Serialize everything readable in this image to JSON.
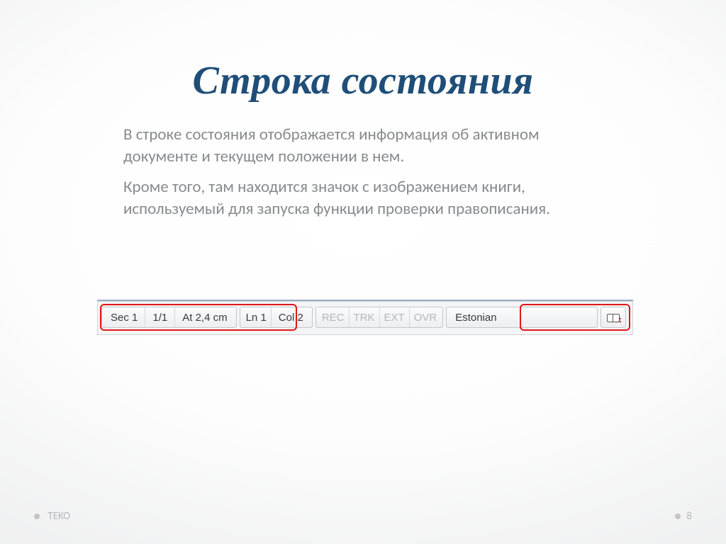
{
  "title": "Строка состояния",
  "body": {
    "p1": "В строке состояния отображается информация об активном документе и текущем положении в нем.",
    "p2": "Кроме того, там находится значок с изображением книги, используемый для запуска функции проверки правописания."
  },
  "statusbar": {
    "section": "Sec 1",
    "page": "1/1",
    "at_label": "At",
    "at_value": "2,4 cm",
    "ln_label": "Ln",
    "ln_value": "1",
    "col_label": "Col",
    "col_value": "2",
    "modes": {
      "rec": "REC",
      "trk": "TRK",
      "ext": "EXT",
      "ovr": "OVR"
    },
    "language": "Estonian"
  },
  "footer": {
    "left": "TEKO",
    "page_number": "8"
  }
}
